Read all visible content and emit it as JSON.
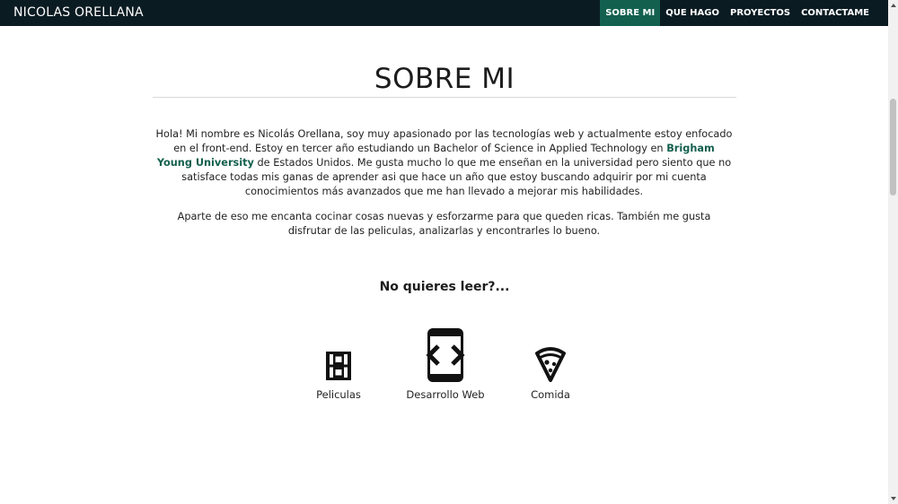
{
  "navbar": {
    "brand": "NICOLAS ORELLANA",
    "links": [
      {
        "label": "SOBRE MI",
        "active": true
      },
      {
        "label": "QUE HAGO",
        "active": false
      },
      {
        "label": "PROYECTOS",
        "active": false
      },
      {
        "label": "CONTACTAME",
        "active": false
      }
    ]
  },
  "about": {
    "title": "SOBRE MI",
    "para1_a": "Hola! Mi nombre es Nicolás Orellana, soy muy apasionado por las tecnologías web y actualmente estoy enfocado en el front-end. Estoy en tercer año estudiando un Bachelor of Science in Applied Technology en ",
    "para1_link": "Brigham Young University",
    "para1_b": " de Estados Unidos. Me gusta mucho lo que me enseñan en la universidad pero siento que no satisface todas mis ganas de aprender asi que hace un año que estoy buscando adquirir por mi cuenta conocimientos más avanzados que me han llevado a mejorar mis habilidades.",
    "para2": "Aparte de eso me encanta cocinar cosas nuevas y esforzarme para que queden ricas. También me gusta disfrutar de las peliculas, analizarlas y encontrarles lo bueno."
  },
  "summary": {
    "subtitle": "No quieres leer?...",
    "features": [
      {
        "icon": "film-icon",
        "label": "Peliculas"
      },
      {
        "icon": "mobile-code-icon",
        "label": "Desarrollo Web"
      },
      {
        "icon": "pizza-icon",
        "label": "Comida"
      }
    ]
  },
  "colors": {
    "navbar_bg": "#0b1b22",
    "accent": "#13604f"
  }
}
